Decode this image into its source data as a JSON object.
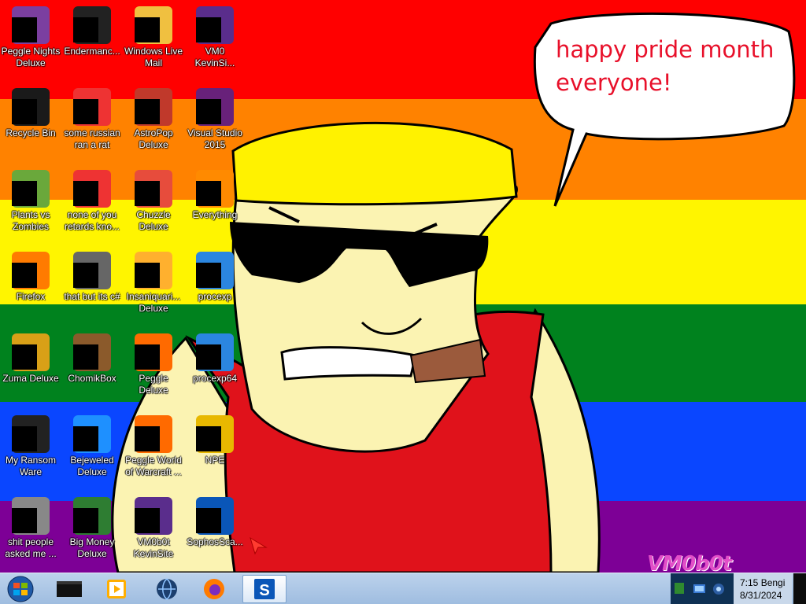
{
  "bubble": {
    "text_line1": "happy pride month",
    "text_line2": "everyone!"
  },
  "signature": "VM0b0t",
  "colors": {
    "red": "#ff0000",
    "orange": "#ff8200",
    "yellow": "#fff500",
    "green": "#00821e",
    "blue": "#0a46ff",
    "purple": "#7d0096",
    "skin": "#fbf3b2",
    "shirt": "#e0121b",
    "cap": "#fff200"
  },
  "icons": [
    {
      "label": "Peggle Nights Deluxe",
      "icon": "peggle-nights-icon"
    },
    {
      "label": "Endermanc...",
      "icon": "terminal-app-icon"
    },
    {
      "label": "Windows Live Mail",
      "icon": "mail-icon"
    },
    {
      "label": "VM0 KevinSi...",
      "icon": "vm0-app-icon"
    },
    {
      "label": "Recycle Bin",
      "icon": "recycle-bin-icon"
    },
    {
      "label": "some russian ran a rat",
      "icon": "program-icon"
    },
    {
      "label": "AstroPop Deluxe",
      "icon": "astropop-icon"
    },
    {
      "label": "Visual Studio 2015",
      "icon": "visual-studio-icon"
    },
    {
      "label": "Plants vs Zombies",
      "icon": "plants-vs-zombies-icon"
    },
    {
      "label": "none of you retards kno...",
      "icon": "program-icon"
    },
    {
      "label": "Chuzzle Deluxe",
      "icon": "chuzzle-icon"
    },
    {
      "label": "Everything",
      "icon": "search-tool-icon"
    },
    {
      "label": "Firefox",
      "icon": "firefox-icon"
    },
    {
      "label": "that but its c#",
      "icon": "shortcut-icon"
    },
    {
      "label": "Insaniquari... Deluxe",
      "icon": "insaniquarium-icon"
    },
    {
      "label": "procexp",
      "icon": "procexp-icon"
    },
    {
      "label": "Zuma Deluxe",
      "icon": "zuma-icon"
    },
    {
      "label": "ChomikBox",
      "icon": "chomikbox-icon"
    },
    {
      "label": "Peggle Deluxe",
      "icon": "peggle-icon"
    },
    {
      "label": "procexp64",
      "icon": "procexp-icon"
    },
    {
      "label": "My Ransom Ware",
      "icon": "terminal-app-icon"
    },
    {
      "label": "Bejeweled Deluxe",
      "icon": "bejeweled-icon"
    },
    {
      "label": "Peggle World of Warcraft ...",
      "icon": "peggle-icon"
    },
    {
      "label": "NPE",
      "icon": "npe-icon"
    },
    {
      "label": "shit people asked me ...",
      "icon": "folder-icon"
    },
    {
      "label": "Big Money Deluxe",
      "icon": "big-money-icon"
    },
    {
      "label": "VM0b0t KevinSite",
      "icon": "vm0-app-icon"
    },
    {
      "label": "SophosSca...",
      "icon": "sophos-icon"
    }
  ],
  "taskbar": {
    "start": "windows-start-icon",
    "pinned": [
      {
        "name": "cmd",
        "icon": "terminal-icon"
      },
      {
        "name": "media-player",
        "icon": "media-player-icon"
      },
      {
        "name": "globe",
        "icon": "globe-icon"
      },
      {
        "name": "firefox",
        "icon": "firefox-icon"
      },
      {
        "name": "sophos",
        "icon": "sophos-icon",
        "active": true
      }
    ],
    "clock": {
      "time": "7:15 Bengi",
      "date": "8/31/2024"
    }
  }
}
